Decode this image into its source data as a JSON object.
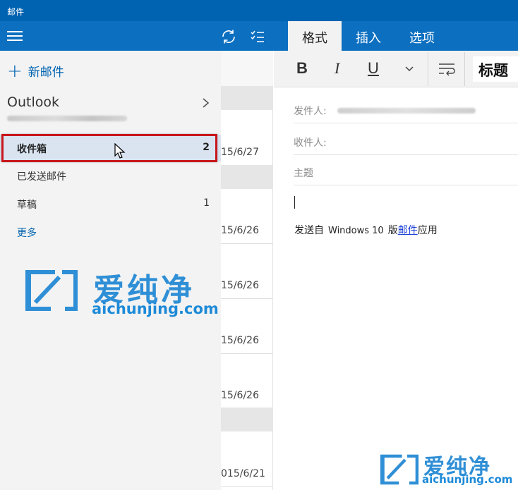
{
  "window": {
    "title": "邮件"
  },
  "header": {
    "tabs": [
      {
        "label": "格式",
        "active": true
      },
      {
        "label": "插入",
        "active": false
      },
      {
        "label": "选项",
        "active": false
      }
    ]
  },
  "nav": {
    "new_mail": "新邮件",
    "account": {
      "name": "Outlook"
    },
    "folders": [
      {
        "label": "收件箱",
        "count": "2",
        "selected": true
      },
      {
        "label": "已发送邮件",
        "count": ""
      },
      {
        "label": "草稿",
        "count": "1"
      },
      {
        "label": "更多",
        "count": ""
      }
    ]
  },
  "list": {
    "dates": [
      "15/6/27",
      "15/6/26",
      "15/6/26",
      "15/6/26",
      "15/6/26",
      "015/6/21"
    ]
  },
  "toolbar": {
    "bold": "B",
    "italic": "I",
    "underline": "U",
    "heading": "标题"
  },
  "compose": {
    "from_label": "发件人:",
    "to_label": "收件人:",
    "subject_placeholder": "主题",
    "signature_prefix": "发送自",
    "signature_windows": "Windows 10",
    "signature_version": "版",
    "signature_link": "邮件",
    "signature_suffix": "应用"
  },
  "watermark": {
    "cn": "爱纯净",
    "en": "aichunjing.com"
  },
  "colors": {
    "accent": "#0c6fc0",
    "titlebar": "#0063b1",
    "highlight_box": "#c8171d",
    "link": "#1a3fd6"
  }
}
